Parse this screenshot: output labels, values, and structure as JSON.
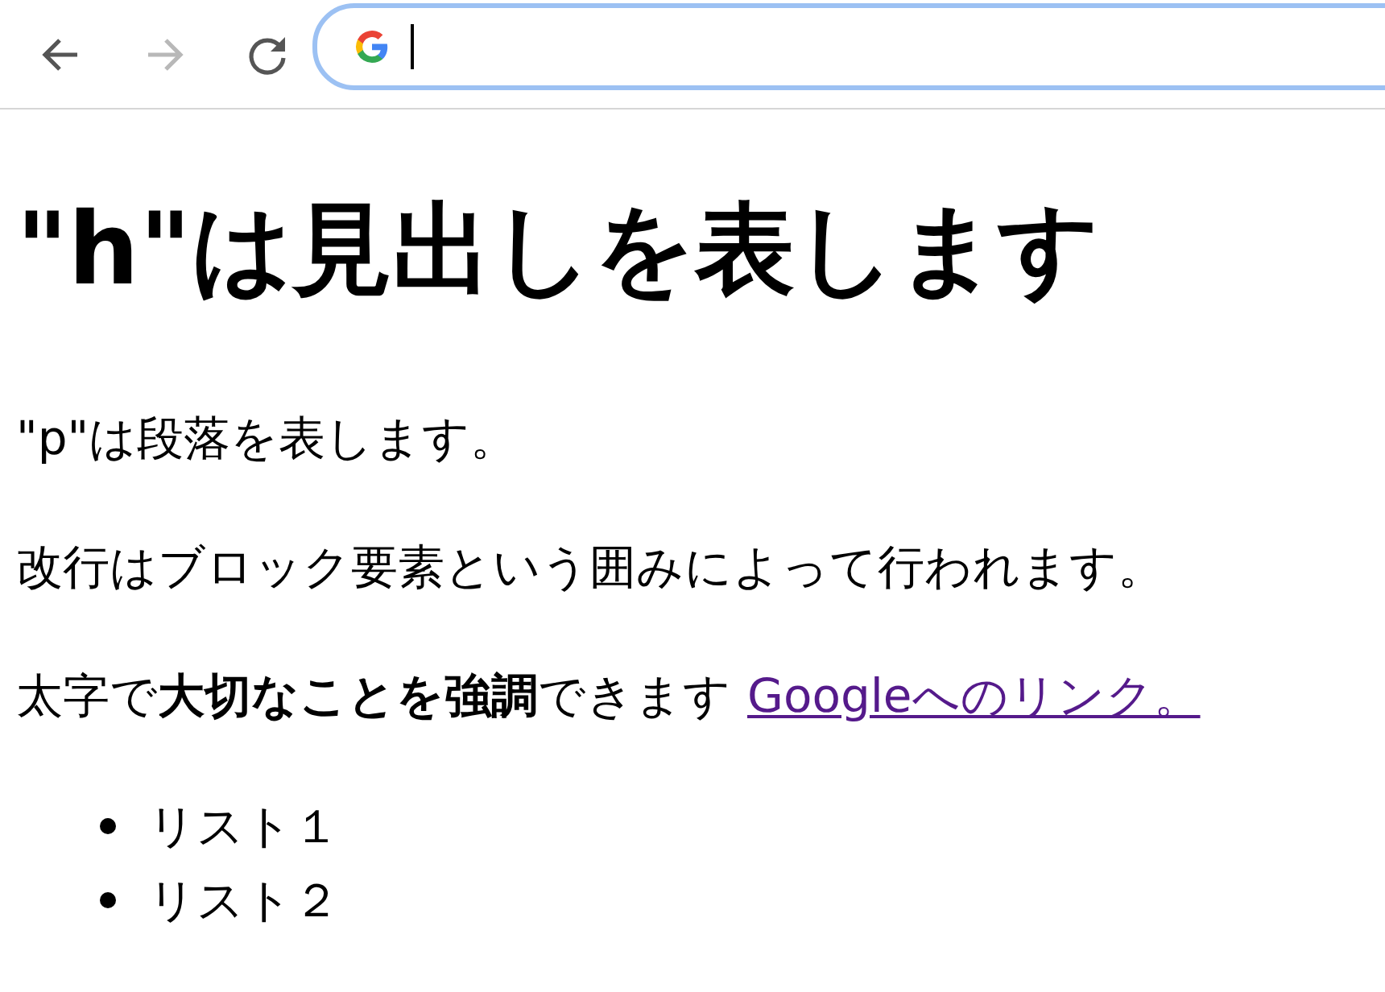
{
  "toolbar": {
    "buttons": [
      {
        "kind": "back",
        "disabled": false
      },
      {
        "kind": "forward",
        "disabled": true
      },
      {
        "kind": "reload",
        "disabled": false
      }
    ],
    "address_bar": {
      "focused": true
    }
  },
  "heading": "\"h\"は見出しを表します",
  "paragraphs": [
    "\"p\"は段落を表します。",
    "改行はブロック要素という囲みによって行われます。"
  ],
  "emphasis_paragraph": {
    "text": "太字で**大切なことを強調**できます",
    "link": "Googleへのリンク。"
  },
  "list": [
    "リスト１",
    "リスト２"
  ]
}
